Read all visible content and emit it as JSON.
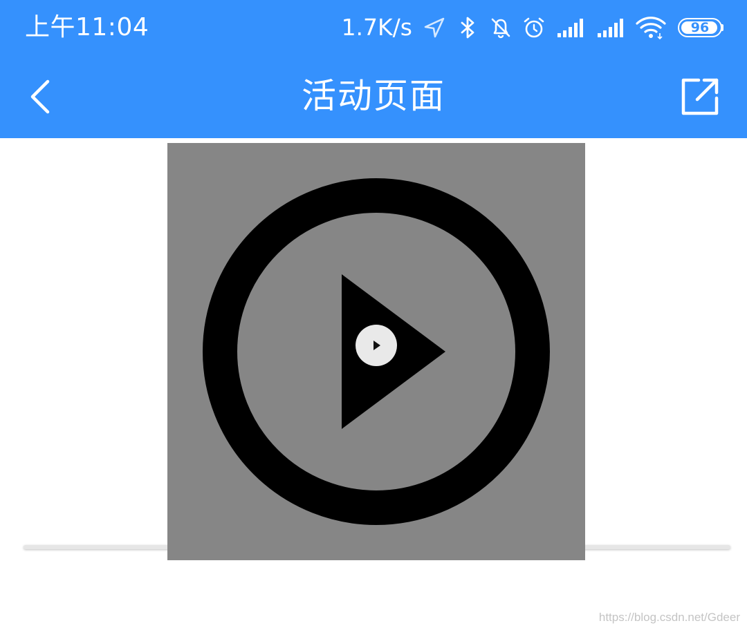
{
  "status_bar": {
    "time": "上午11:04",
    "net_speed": "1.7K/s",
    "battery_level": 96,
    "battery_label": "96",
    "icons": [
      "location-arrow-icon",
      "bluetooth-icon",
      "mute-bell-icon",
      "alarm-clock-icon",
      "signal-icon",
      "signal-icon",
      "wifi-icon",
      "battery-icon"
    ]
  },
  "header": {
    "title": "活动页面",
    "back_icon": "chevron-left-icon",
    "share_icon": "external-link-icon"
  },
  "video": {
    "poster_icon": "play-circle-icon",
    "play_icon": "play-icon"
  },
  "watermark": "https://blog.csdn.net/Gdeer",
  "colors": {
    "brand": "#3591fd",
    "poster_bg": "#868686",
    "play_button_bg": "#e9e9e9"
  }
}
